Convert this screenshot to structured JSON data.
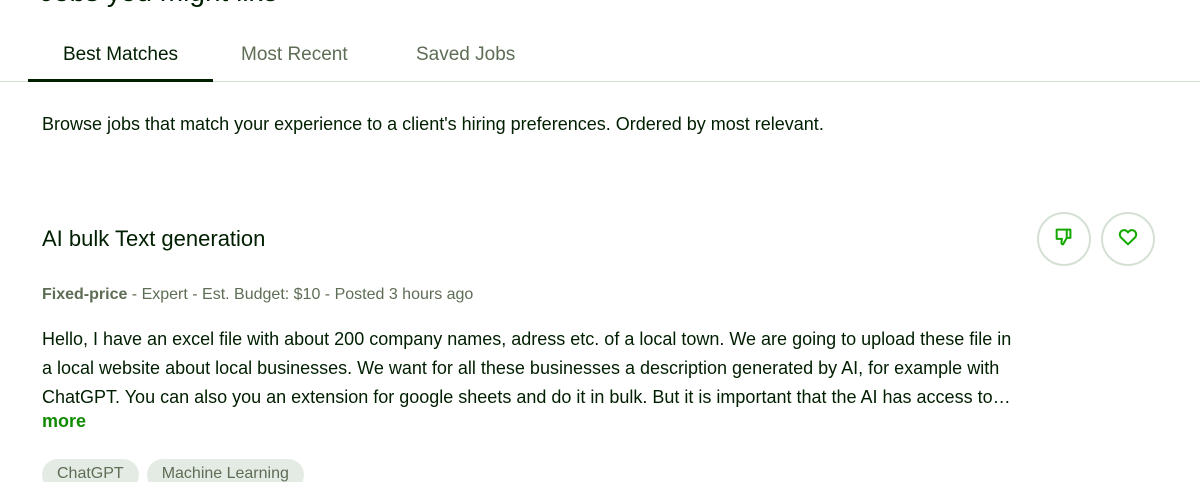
{
  "section": {
    "title": "Jobs you might like"
  },
  "tabs": [
    {
      "label": "Best Matches",
      "active": true
    },
    {
      "label": "Most Recent",
      "active": false
    },
    {
      "label": "Saved Jobs",
      "active": false
    }
  ],
  "intro": "Browse jobs that match your experience to a client's hiring preferences. Ordered by most relevant.",
  "job": {
    "title": "AI bulk Text generation",
    "job_type": "Fixed-price",
    "meta_rest": " - Expert - Est. Budget: $10 - Posted 3 hours ago",
    "description_lines": [
      "Hello, I have an excel file with about 200 company names, adress etc. of a local town. We are going to upload these file in",
      "a local website about local businesses. We want for all these businesses a description generated by AI, for example with",
      "ChatGPT. You can also you an extension for google sheets and do it in bulk. But it is important that the AI has access to…"
    ],
    "more_label": "more",
    "skills": [
      "ChatGPT",
      "Machine Learning"
    ],
    "actions": {
      "dislike_icon": "thumbs-down-icon",
      "save_icon": "heart-icon"
    }
  },
  "colors": {
    "text_primary": "#001e00",
    "text_secondary": "#5e6d55",
    "accent_green": "#108a00",
    "icon_green": "#14a800",
    "border": "#d5e0d5",
    "chip_bg": "#e4ebe4"
  }
}
